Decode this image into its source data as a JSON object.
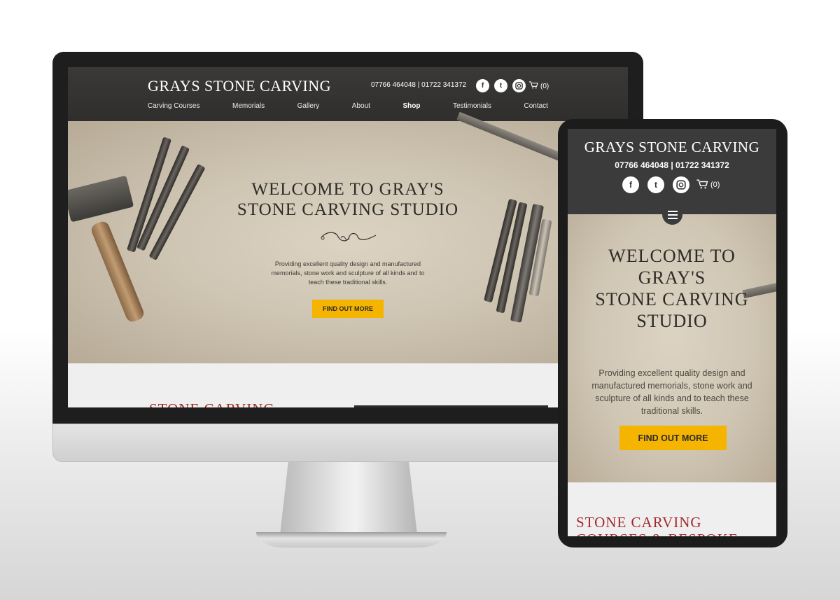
{
  "site": {
    "logo": "GRAYS STONE CARVING",
    "phone": "07766 464048  |  01722 341372",
    "phone_mobile": "07766 464048 | 01722 341372",
    "cart": "(0)",
    "social_icons": [
      "facebook-icon",
      "twitter-icon",
      "instagram-icon"
    ],
    "accent_color": "#f5b400",
    "title_color": "#a3282c"
  },
  "nav": {
    "items": [
      "Carving  Courses",
      "Memorials",
      "Gallery",
      "About",
      "Shop",
      "Testimonials",
      "Contact"
    ],
    "active": "Shop"
  },
  "hero": {
    "title_line1": "WELCOME TO GRAY'S",
    "title_line2": "STONE CARVING STUDIO",
    "mobile_title_line1": "WELCOME TO",
    "mobile_title_line2": "GRAY'S",
    "mobile_title_line3": "STONE CARVING",
    "mobile_title_line4": "STUDIO",
    "intro": "Providing excellent quality design and manufactured memorials, stone work and sculpture of all kinds and to teach these traditional skills.",
    "button": "FIND OUT MORE"
  },
  "section": {
    "desktop_title": "STONE CARVING",
    "mobile_title_line1": "STONE CARVING",
    "mobile_title_line2": "COURSES & BESPOKE"
  }
}
